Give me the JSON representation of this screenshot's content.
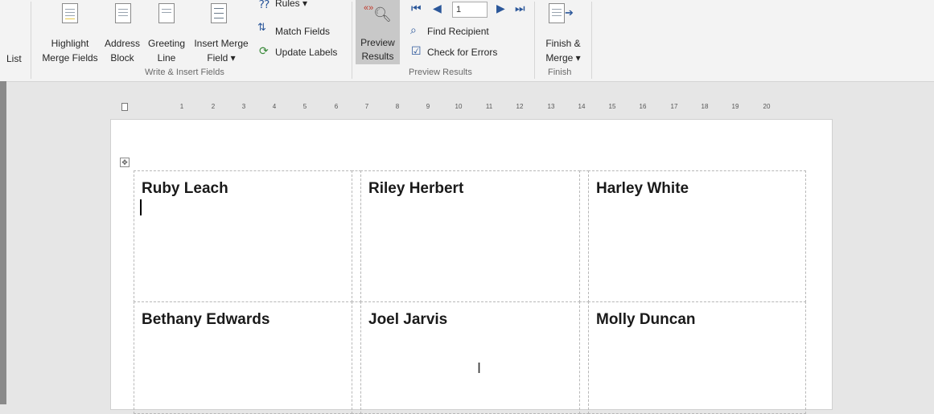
{
  "ribbon": {
    "list_label": "List",
    "highlight": [
      "Highlight",
      "Merge Fields"
    ],
    "address": [
      "Address",
      "Block"
    ],
    "greeting": [
      "Greeting",
      "Line"
    ],
    "insert_merge": [
      "Insert Merge",
      "Field ▾"
    ],
    "rules": "Rules ▾",
    "match_fields": "Match Fields",
    "update_labels": "Update Labels",
    "preview": [
      "Preview",
      "Results"
    ],
    "record_value": "1",
    "find_recipient": "Find Recipient",
    "check_errors": "Check for Errors",
    "finish": [
      "Finish &",
      "Merge ▾"
    ],
    "groups": {
      "write_insert": "Write & Insert Fields",
      "preview_results": "Preview Results",
      "finish": "Finish"
    }
  },
  "ruler": {
    "ticks": [
      "1",
      "2",
      "3",
      "4",
      "5",
      "6",
      "7",
      "8",
      "9",
      "10",
      "11",
      "12",
      "13",
      "14",
      "15",
      "16",
      "17",
      "18",
      "19",
      "20"
    ]
  },
  "labels": [
    [
      "Ruby Leach",
      "Riley Herbert",
      "Harley White"
    ],
    [
      "Bethany Edwards",
      "Joel Jarvis",
      "Molly Duncan"
    ]
  ]
}
